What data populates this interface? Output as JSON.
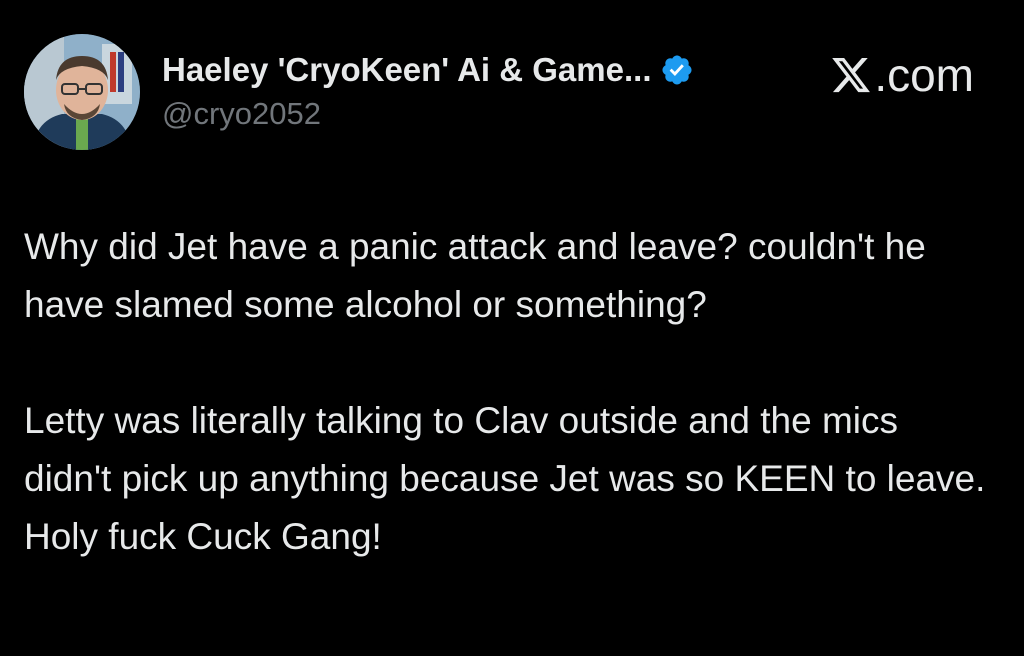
{
  "author": {
    "display_name": "Haeley 'CryoKeen' Ai & Game...",
    "handle": "@cryo2052",
    "verified_icon": "verified-badge-icon",
    "avatar_icon": "avatar"
  },
  "brand": {
    "logo_icon": "x-logo-icon",
    "label": ".com"
  },
  "tweet": {
    "paragraphs": [
      "Why did Jet have a panic attack and leave? couldn't he have slamed some alcohol or something?",
      "Letty was literally talking to Clav outside and the mics didn't pick up anything because Jet was so KEEN to leave. Holy fuck Cuck Gang!"
    ]
  },
  "colors": {
    "background": "#000000",
    "text": "#e7e9ea",
    "muted": "#71767b",
    "verified": "#1d9bf0"
  }
}
